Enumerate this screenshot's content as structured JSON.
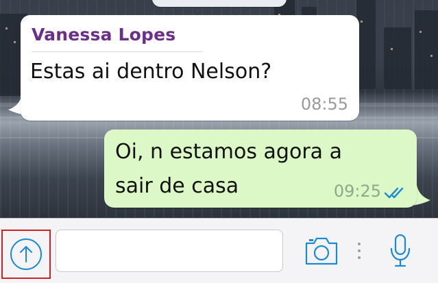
{
  "chat": {
    "incoming": {
      "sender": "Vanessa Lopes",
      "text": "Estas ai dentro Nelson?",
      "time": "08:55"
    },
    "outgoing": {
      "line1": "Oi, n estamos agora a",
      "line2": "sair de casa",
      "time": "09:25",
      "status_icon": "double-check-read-icon"
    }
  },
  "toolbar": {
    "share_icon": "upload-arrow-icon",
    "input_value": "",
    "input_placeholder": "",
    "camera_icon": "camera-icon",
    "mic_icon": "microphone-icon"
  },
  "colors": {
    "accent_blue": "#1a8ad4",
    "sender_purple": "#6b2f8a",
    "outgoing_bubble": "#dcf8c6",
    "highlight_red": "#cc2222"
  }
}
